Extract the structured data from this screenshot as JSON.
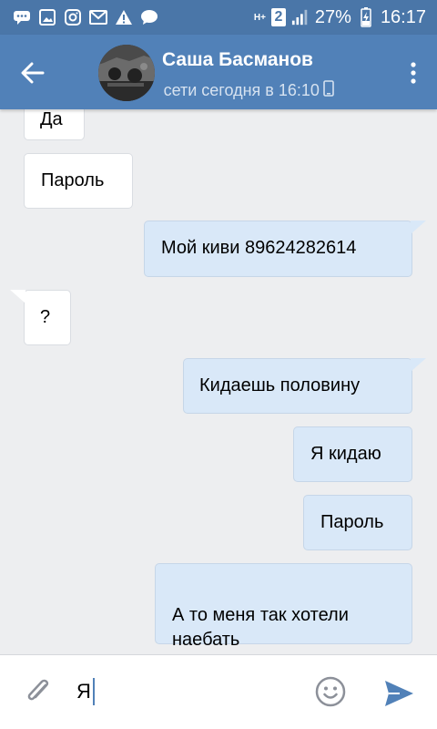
{
  "status_bar": {
    "network_label": "H+",
    "sim_number": "2",
    "battery": "27%",
    "time": "16:17",
    "notification_icons": [
      "chat-icon",
      "image-icon",
      "instagram-icon",
      "mail-icon",
      "alert-icon",
      "message-icon"
    ]
  },
  "header": {
    "contact_name": "Саша Басманов",
    "contact_status": "в сети сегодня в 16:10",
    "device_icon": "phone-icon"
  },
  "messages": [
    {
      "direction": "incoming",
      "text": "Да"
    },
    {
      "direction": "incoming",
      "text": "Пароль"
    },
    {
      "direction": "outgoing",
      "text": "Мой киви 89624282614"
    },
    {
      "direction": "incoming",
      "text": "?"
    },
    {
      "direction": "outgoing",
      "text": "Кидаешь половину"
    },
    {
      "direction": "outgoing",
      "text": "Я кидаю"
    },
    {
      "direction": "outgoing",
      "text": "Пароль"
    },
    {
      "direction": "outgoing",
      "text": "А то меня так хотели\nнаебать"
    }
  ],
  "composer": {
    "input_value": "Я"
  },
  "colors": {
    "status_bar": "#4a76a8",
    "toolbar": "#5181b8",
    "chat_background": "#edeef0",
    "outgoing_bubble": "#d9e8f8",
    "incoming_bubble": "#ffffff",
    "send_button": "#5181b8"
  }
}
